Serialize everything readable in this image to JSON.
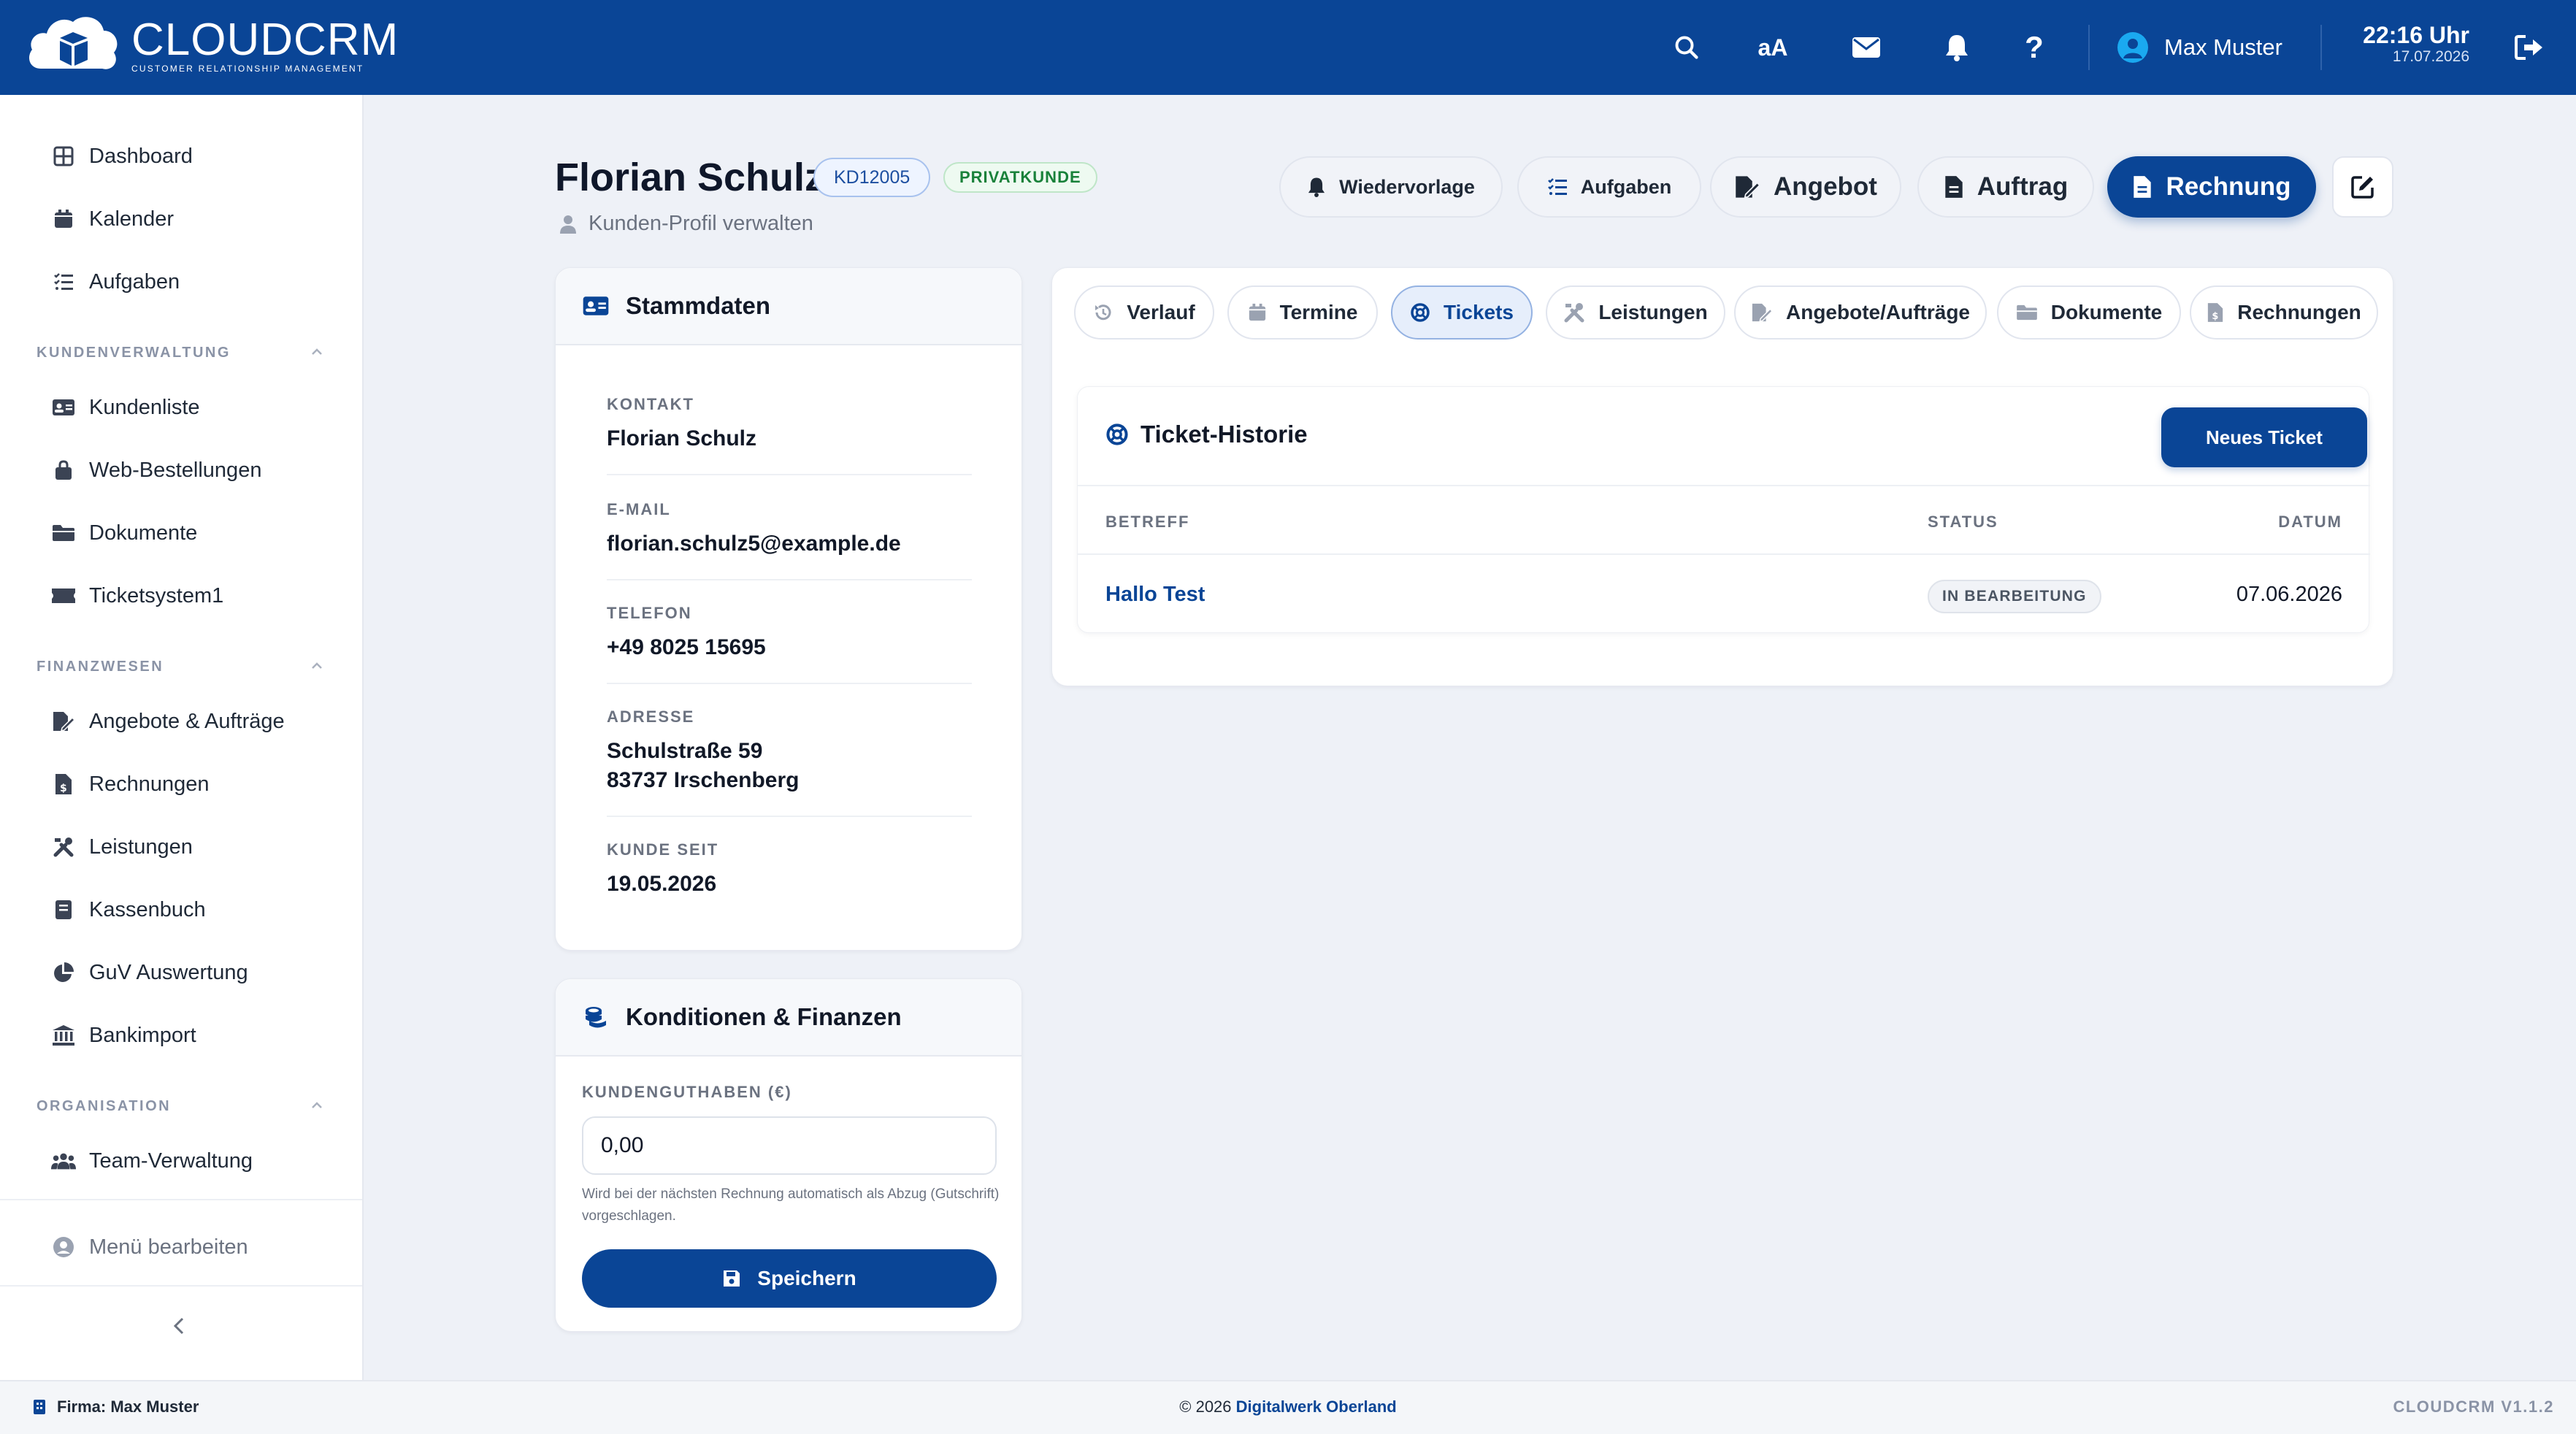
{
  "app": {
    "logo_name": "CLOUDCRM",
    "logo_sub": "CUSTOMER RELATIONSHIP MANAGEMENT"
  },
  "topbar": {
    "text_size_label": "aA",
    "user_name": "Max Muster",
    "time": "22:16 Uhr",
    "date": "17.07.2026"
  },
  "sidebar": {
    "top_items": [
      {
        "label": "Dashboard",
        "icon": "dashboard-icon"
      },
      {
        "label": "Kalender",
        "icon": "calendar-icon"
      },
      {
        "label": "Aufgaben",
        "icon": "tasks-icon"
      }
    ],
    "sections": [
      {
        "title": "KUNDENVERWALTUNG",
        "items": [
          {
            "label": "Kundenliste",
            "icon": "id-card-icon"
          },
          {
            "label": "Web-Bestellungen",
            "icon": "shopping-bag-icon"
          },
          {
            "label": "Dokumente",
            "icon": "folder-icon"
          },
          {
            "label": "Ticketsystem1",
            "icon": "ticket-icon"
          }
        ]
      },
      {
        "title": "FINANZWESEN",
        "items": [
          {
            "label": "Angebote & Aufträge",
            "icon": "file-signature-icon"
          },
          {
            "label": "Rechnungen",
            "icon": "invoice-icon"
          },
          {
            "label": "Leistungen",
            "icon": "tools-icon"
          },
          {
            "label": "Kassenbuch",
            "icon": "book-icon"
          },
          {
            "label": "GuV Auswertung",
            "icon": "pie-chart-icon"
          },
          {
            "label": "Bankimport",
            "icon": "bank-icon"
          }
        ]
      },
      {
        "title": "ORGANISATION",
        "items": [
          {
            "label": "Team-Verwaltung",
            "icon": "team-icon"
          }
        ]
      }
    ],
    "edit_menu_label": "Menü bearbeiten"
  },
  "customer": {
    "name": "Florian Schulz",
    "id": "KD12005",
    "type": "PRIVATKUNDE",
    "subtitle": "Kunden-Profil verwalten"
  },
  "actions": {
    "wiedervorlage": "Wiedervorlage",
    "aufgaben": "Aufgaben",
    "angebot": "Angebot",
    "auftrag": "Auftrag",
    "rechnung": "Rechnung"
  },
  "stammdaten": {
    "title": "Stammdaten",
    "kontakt_label": "KONTAKT",
    "kontakt": "Florian Schulz",
    "email_label": "E-MAIL",
    "email": "florian.schulz5@example.de",
    "telefon_label": "TELEFON",
    "telefon": "+49 8025 15695",
    "adresse_label": "ADRESSE",
    "adresse_line1": "Schulstraße 59",
    "adresse_line2": "83737 Irschenberg",
    "kunde_seit_label": "KUNDE SEIT",
    "kunde_seit": "19.05.2026"
  },
  "konditionen": {
    "title": "Konditionen & Finanzen",
    "guthaben_label": "KUNDENGUTHABEN (€)",
    "guthaben_value": "0,00",
    "hint": "Wird bei der nächsten Rechnung automatisch als Abzug (Gutschrift) vorgeschlagen.",
    "save_label": "Speichern"
  },
  "tabs": [
    {
      "label": "Verlauf",
      "icon": "history-icon"
    },
    {
      "label": "Termine",
      "icon": "calendar-icon"
    },
    {
      "label": "Tickets",
      "icon": "lifering-icon",
      "active": true
    },
    {
      "label": "Leistungen",
      "icon": "tools-icon"
    },
    {
      "label": "Angebote/Aufträge",
      "icon": "file-signature-icon"
    },
    {
      "label": "Dokumente",
      "icon": "folder-icon"
    },
    {
      "label": "Rechnungen",
      "icon": "invoice-icon"
    }
  ],
  "tickets": {
    "title": "Ticket-Historie",
    "new_label": "Neues Ticket",
    "columns": {
      "betreff": "BETREFF",
      "status": "STATUS",
      "datum": "DATUM"
    },
    "rows": [
      {
        "betreff": "Hallo Test",
        "status": "IN BEARBEITUNG",
        "datum": "07.06.2026"
      }
    ]
  },
  "footer": {
    "firma": "Firma: Max Muster",
    "copyright": "© 2026",
    "company_link": "Digitalwerk Oberland",
    "version": "CLOUDCRM V1.1.2"
  },
  "colors": {
    "brand": "#0a4596",
    "background": "#eef1f7",
    "success": "#19813a"
  }
}
